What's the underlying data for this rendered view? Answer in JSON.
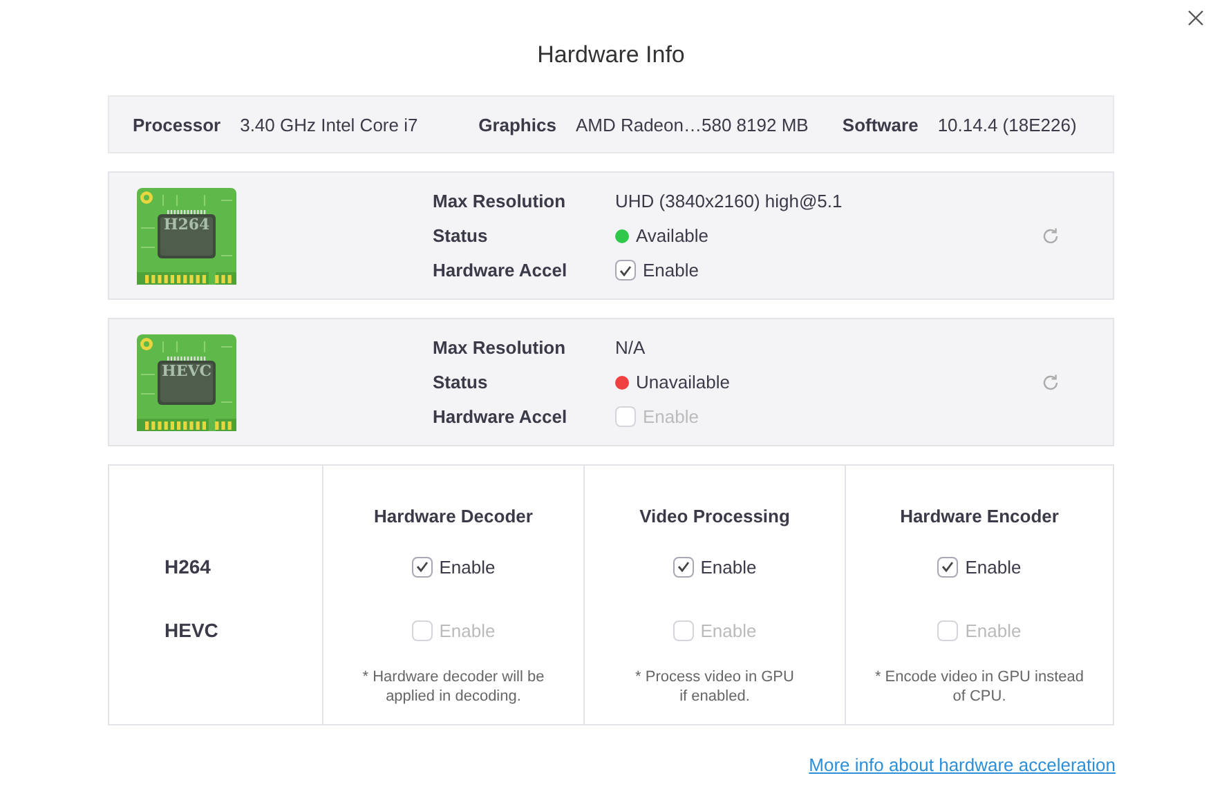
{
  "window": {
    "title": "Hardware Info"
  },
  "system": [
    {
      "label": "Processor",
      "value": "3.40 GHz Intel Core i7"
    },
    {
      "label": "Graphics",
      "value": "AMD Radeon…580 8192 MB"
    },
    {
      "label": "Software",
      "value": "10.14.4 (18E226)"
    }
  ],
  "codecs": [
    {
      "chip_label": "H264",
      "rows": [
        {
          "kind": "text",
          "label": "Max Resolution",
          "value": "UHD (3840x2160) high@5.1"
        },
        {
          "kind": "status",
          "label": "Status",
          "value": "Available",
          "color": "#2fc84a"
        },
        {
          "kind": "checkbox",
          "label": "Hardware Accel",
          "value": "Enable",
          "checked": true,
          "disabled": false
        }
      ]
    },
    {
      "chip_label": "HEVC",
      "rows": [
        {
          "kind": "text",
          "label": "Max Resolution",
          "value": "N/A"
        },
        {
          "kind": "status",
          "label": "Status",
          "value": "Unavailable",
          "color": "#f04040"
        },
        {
          "kind": "checkbox",
          "label": "Hardware Accel",
          "value": "Enable",
          "checked": false,
          "disabled": true
        }
      ]
    }
  ],
  "table": {
    "header": [
      "Hardware Decoder",
      "Video Processing",
      "Hardware Encoder"
    ],
    "rows": [
      {
        "label": "H264",
        "cells": [
          {
            "text": "Enable",
            "checked": true,
            "disabled": false
          },
          {
            "text": "Enable",
            "checked": true,
            "disabled": false
          },
          {
            "text": "Enable",
            "checked": true,
            "disabled": false
          }
        ]
      },
      {
        "label": "HEVC",
        "cells": [
          {
            "text": "Enable",
            "checked": false,
            "disabled": true
          },
          {
            "text": "Enable",
            "checked": false,
            "disabled": true
          },
          {
            "text": "Enable",
            "checked": false,
            "disabled": true
          }
        ]
      }
    ],
    "notes": [
      "* Hardware decoder will be\napplied in decoding.",
      "* Process video in GPU\nif enabled.",
      "* Encode video in GPU instead\nof CPU."
    ]
  },
  "link": "More info about hardware acceleration"
}
